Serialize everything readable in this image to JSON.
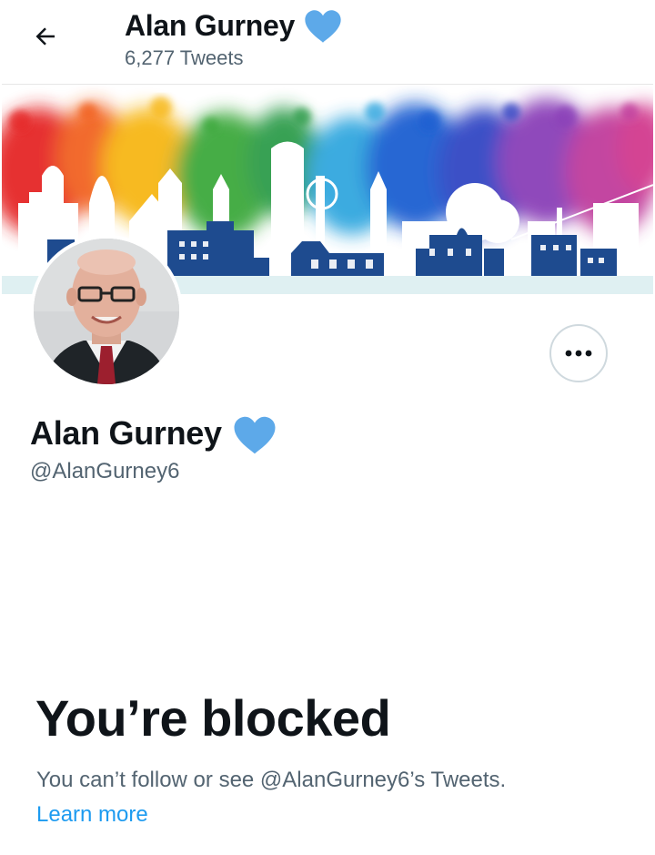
{
  "header": {
    "back_icon": "arrow-left-icon",
    "title": "Alan Gurney",
    "verified_icon": "blue-heart-icon",
    "tweet_count": "6,277 Tweets"
  },
  "banner": {
    "description_icon": "rainbow-city-skyline-banner"
  },
  "profile": {
    "name": "Alan Gurney",
    "handle": "@AlanGurney6",
    "badge_icon": "blue-heart-icon",
    "more_icon": "more-horizontal-icon"
  },
  "blocked": {
    "title": "You’re blocked",
    "description": "You can’t follow or see @AlanGurney6’s Tweets.",
    "learn_more": "Learn more"
  },
  "colors": {
    "text_primary": "#0f1419",
    "text_secondary": "#536471",
    "link": "#1d9bf0",
    "heart": "#5da9e9",
    "skyline_navy": "#1e4b8f",
    "border": "#cfd9de"
  }
}
